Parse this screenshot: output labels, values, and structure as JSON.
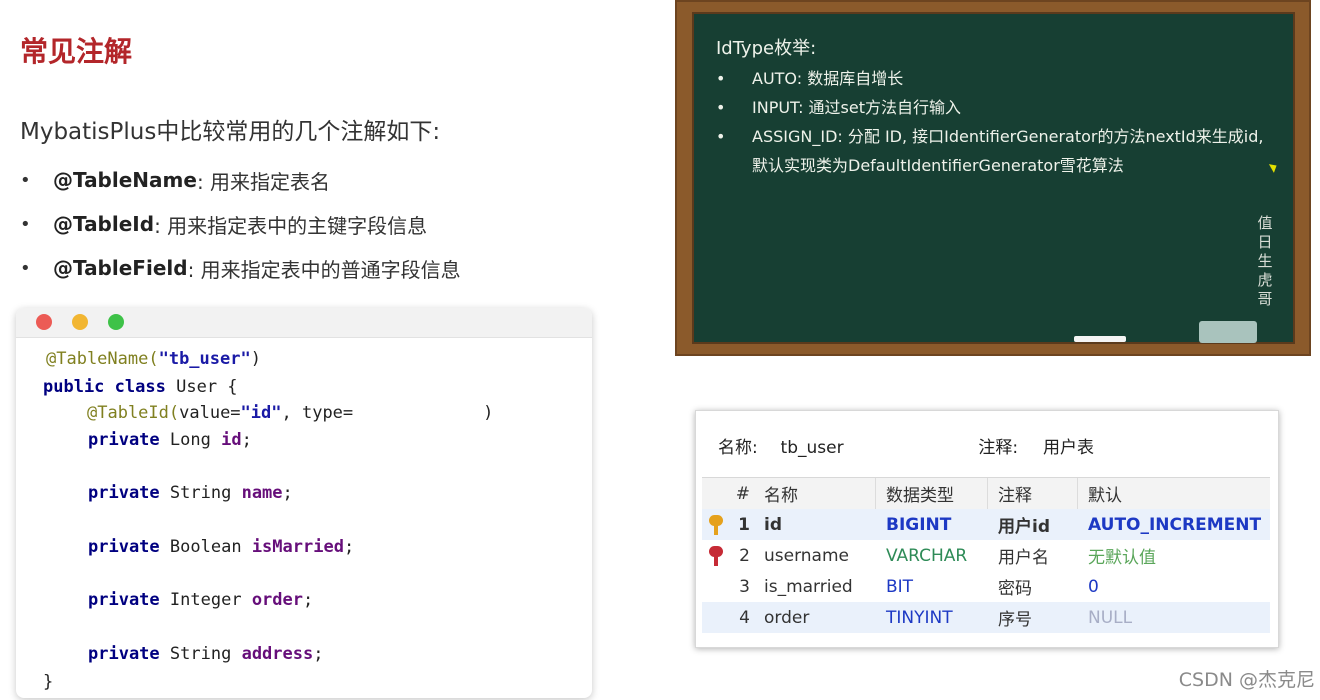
{
  "slide": {
    "title": "常见注解",
    "intro": "MybatisPlus中比较常用的几个注解如下:",
    "bullets": [
      {
        "marker": "•",
        "name": "@TableName",
        "desc": ": 用来指定表名"
      },
      {
        "marker": "•",
        "name": "@TableId",
        "desc": ": 用来指定表中的主键字段信息"
      },
      {
        "marker": "•",
        "name": "@TableField",
        "desc": ": 用来指定表中的普通字段信息"
      }
    ]
  },
  "code": {
    "l1_ann": "@TableName(",
    "l1_str": "\"tb_user\"",
    "l1_end": ")",
    "l2_kw1": "public",
    "l2_kw2": "class",
    "l2_rest": "User {",
    "l3_ann": "@TableId(",
    "l3_attr": "value=",
    "l3_str": "\"id\"",
    "l3_mid": ", type=",
    "l3_end": ")",
    "fields": [
      {
        "kw": "private",
        "type": "Long",
        "name": "id",
        "end": ";"
      },
      {
        "kw": "private",
        "type": "String",
        "name": "name",
        "end": ";"
      },
      {
        "kw": "private",
        "type": "Boolean",
        "name": "isMarried",
        "end": ";"
      },
      {
        "kw": "private",
        "type": "Integer",
        "name": "order",
        "end": ";"
      },
      {
        "kw": "private",
        "type": "String",
        "name": "address",
        "end": ";"
      }
    ],
    "close": "}"
  },
  "board": {
    "heading": "IdType枚举:",
    "items": [
      {
        "bullet": "•",
        "text": "AUTO: 数据库自增长"
      },
      {
        "bullet": "•",
        "text": "INPUT: 通过set方法自行输入"
      },
      {
        "bullet": "•",
        "text": "ASSIGN_ID: 分配 ID, 接口IdentifierGenerator的方法nextId来生成id,"
      }
    ],
    "continuation": "默认实现类为DefaultIdentifierGenerator雪花算法",
    "signature": "值日生虎哥"
  },
  "table_info": {
    "name_label": "名称:",
    "name_value": "tb_user",
    "comment_label": "注释:",
    "comment_value": "用户表",
    "headers": {
      "num": "#",
      "name": "名称",
      "type": "数据类型",
      "comment": "注释",
      "default": "默认"
    },
    "rows": [
      {
        "num": "1",
        "name": "id",
        "type": "BIGINT",
        "comment": "用户id",
        "default": "AUTO_INCREMENT",
        "icon": "primary-key-icon"
      },
      {
        "num": "2",
        "name": "username",
        "type": "VARCHAR",
        "comment": "用户名",
        "default": "无默认值",
        "icon": "unique-key-icon"
      },
      {
        "num": "3",
        "name": "is_married",
        "type": "BIT",
        "comment": "密码",
        "default": "0",
        "icon": ""
      },
      {
        "num": "4",
        "name": "order",
        "type": "TINYINT",
        "comment": "序号",
        "default": "NULL",
        "icon": ""
      }
    ]
  },
  "colors": {
    "title": "#b3262a",
    "board": "#173f33",
    "frame": "#8b5a2b",
    "type_blue": "#1d39c4",
    "type_green": "#2e8b57",
    "default_green": "#5aa65a",
    "null_gray": "#a8aec6",
    "primary_key": "#e5a11c",
    "unique_key": "#c62a35"
  },
  "watermark": "CSDN @杰克尼"
}
